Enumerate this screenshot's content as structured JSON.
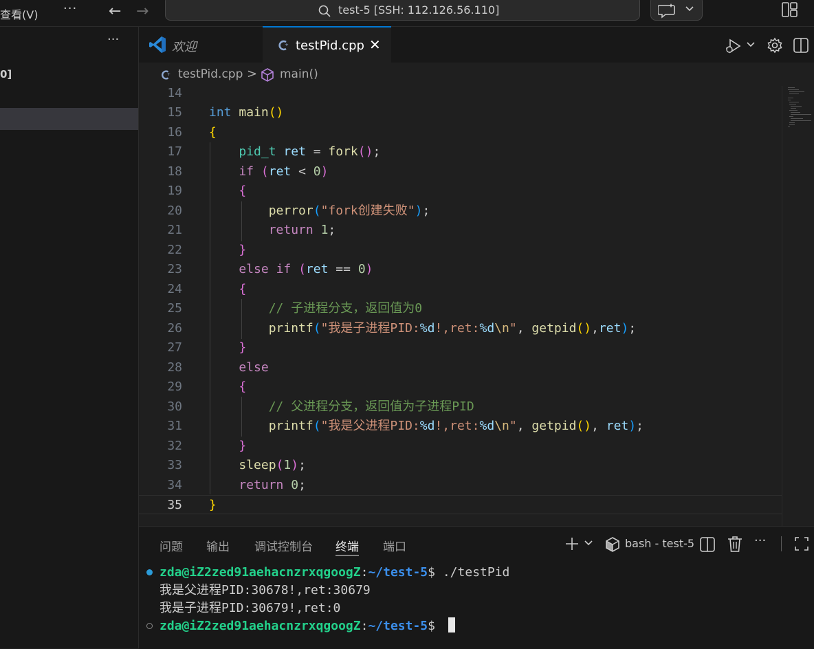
{
  "titlebar": {
    "menu_view": "查看(V)",
    "menu_more": "···",
    "back": "←",
    "forward": "→",
    "search_title": "test-5 [SSH: 112.126.56.110]"
  },
  "sidebar": {
    "more": "···",
    "fragment": "0]"
  },
  "tabs": [
    {
      "label": "欢迎",
      "icon": "vscode-logo-icon",
      "active": false
    },
    {
      "label": "testPid.cpp",
      "icon": "cpp-file-icon",
      "active": true,
      "close": "✕"
    }
  ],
  "breadcrumb": {
    "file": "testPid.cpp",
    "separator": ">",
    "symbol": "main()"
  },
  "editor": {
    "current_line": 35,
    "lines": [
      {
        "n": "14"
      },
      {
        "n": "15"
      },
      {
        "n": "16"
      },
      {
        "n": "17"
      },
      {
        "n": "18"
      },
      {
        "n": "19"
      },
      {
        "n": "20"
      },
      {
        "n": "21"
      },
      {
        "n": "22"
      },
      {
        "n": "23"
      },
      {
        "n": "24"
      },
      {
        "n": "25"
      },
      {
        "n": "26"
      },
      {
        "n": "27"
      },
      {
        "n": "28"
      },
      {
        "n": "29"
      },
      {
        "n": "30"
      },
      {
        "n": "31"
      },
      {
        "n": "32"
      },
      {
        "n": "33"
      },
      {
        "n": "34"
      },
      {
        "n": "35"
      }
    ],
    "tokens": {
      "int": "int",
      "main": "main",
      "pid_t": "pid_t",
      "ret": "ret",
      "fork": "fork",
      "if": "if",
      "lt": " < ",
      "zero": "0",
      "perror": "perror",
      "perror_str": "\"fork创建失败\"",
      "return": "return",
      "one": "1",
      "else": "else",
      "eqeq": " == ",
      "comment_child": "// 子进程分支，返回值为0",
      "comment_parent": "// 父进程分支，返回值为子进程PID",
      "printf": "printf",
      "child_str_a": "\"我是子进程PID:",
      "parent_str_a": "\"我是父进程PID:",
      "fmt_d": "%d",
      "str_b": "!,ret:",
      "esc_n": "\\n",
      "quote": "\"",
      "getpid": "getpid",
      "sleep": "sleep"
    }
  },
  "panel": {
    "tabs": [
      "问题",
      "输出",
      "调试控制台",
      "终端",
      "端口"
    ],
    "active_tab": "终端",
    "terminal_name": "bash - test-5",
    "more": "···"
  },
  "terminal": {
    "user_host": "zda@iZ2zed91aehacnzrxqgoogZ",
    "colon": ":",
    "path": "~/test-5",
    "prompt": "$ ",
    "command1": "./testPid",
    "output1": "我是父进程PID:30678!,ret:30679",
    "output2": "我是子进程PID:30679!,ret:0"
  },
  "colors": {
    "accent": "#0078d4",
    "editor_bg": "#1f1f1f",
    "chrome_bg": "#181818"
  }
}
